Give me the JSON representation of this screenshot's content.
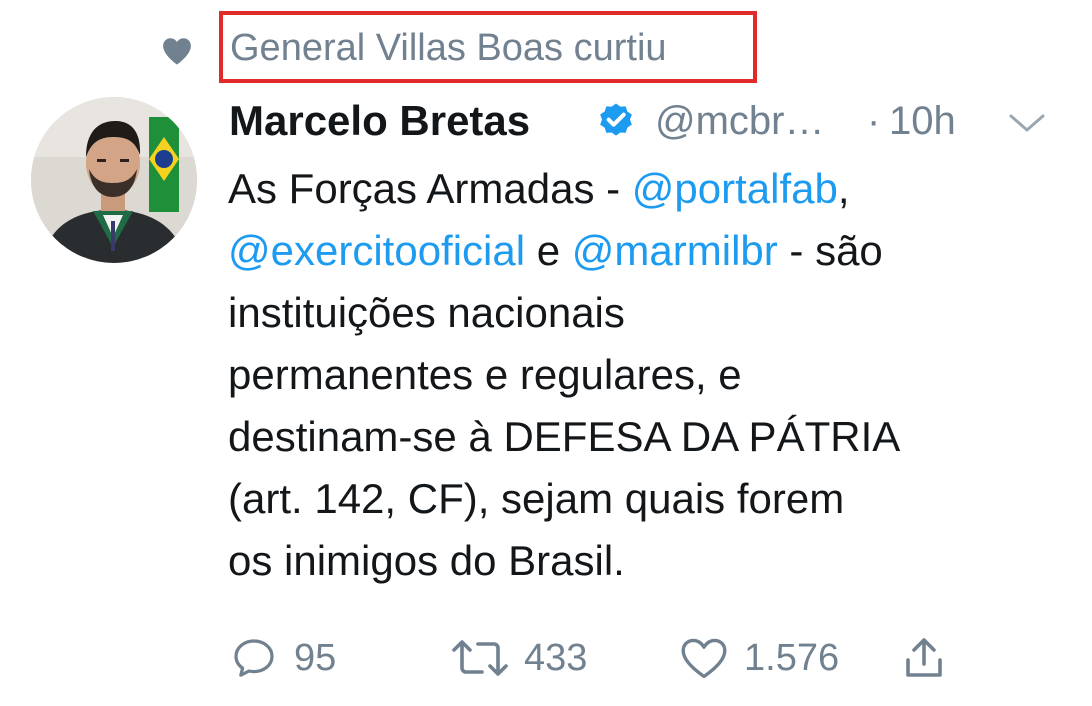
{
  "social_context": {
    "icon": "heart-icon",
    "text": "General Villas Boas curtiu",
    "highlight_color": "#e12a2a"
  },
  "tweet": {
    "author": {
      "display_name": "Marcelo Bretas",
      "verified": true,
      "handle": "@mcbr…",
      "avatar": "avatar-photo"
    },
    "separator": "·",
    "timestamp": "10h",
    "menu_icon": "chevron-down-icon",
    "text_lines": [
      [
        {
          "t": "As Forças Armadas - "
        },
        {
          "t": "@portalfab",
          "mention": true
        },
        {
          "t": ","
        }
      ],
      [
        {
          "t": "@exercitooficial",
          "mention": true
        },
        {
          "t": " e "
        },
        {
          "t": "@marmilbr",
          "mention": true
        },
        {
          "t": " - são"
        }
      ],
      [
        {
          "t": "instituições nacionais"
        }
      ],
      [
        {
          "t": "permanentes e regulares, e"
        }
      ],
      [
        {
          "t": "destinam-se à DEFESA DA PÁTRIA"
        }
      ],
      [
        {
          "t": "(art. 142, CF), sejam quais forem"
        }
      ],
      [
        {
          "t": "os inimigos do Brasil."
        }
      ]
    ],
    "actions": {
      "reply": {
        "icon": "reply-icon",
        "count": "95"
      },
      "retweet": {
        "icon": "retweet-icon",
        "count": "433"
      },
      "like": {
        "icon": "heart-outline-icon",
        "count": "1.576"
      },
      "share": {
        "icon": "share-icon"
      }
    }
  },
  "colors": {
    "mention": "#1d9bf0",
    "secondary_text": "#71818f",
    "verified_badge": "#1d9bf0",
    "primary_text": "#14171a"
  }
}
